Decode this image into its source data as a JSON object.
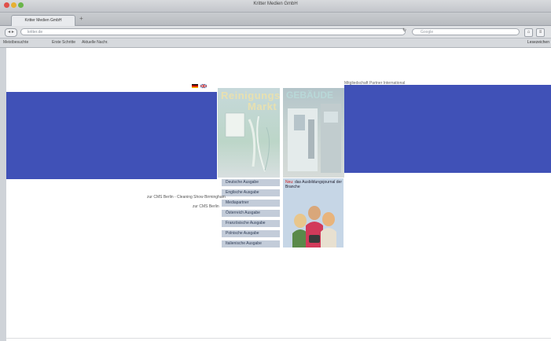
{
  "window": {
    "title": "Kritter Medien GmbH"
  },
  "tab": {
    "label": "Kritter Medien GmbH",
    "newtab": "+"
  },
  "toolbar": {
    "back": "◂ ▸",
    "url": "kritter.de",
    "reload": "↻",
    "search_placeholder": "Google",
    "home": "⌂",
    "menu": "≡"
  },
  "bookmarks": {
    "items": [
      "Meistbesuchte",
      "Erste Schritte",
      "Aktuelle Nachr."
    ],
    "right": "Lesezeichen"
  },
  "page": {
    "partner_link": "Mitgliedschaft Partner International",
    "mag1": {
      "line1": "Reinigungs",
      "line2": "Markt"
    },
    "mag2": {
      "title": "GEBÄUDE"
    },
    "editions": [
      "Deutsche Ausgabe",
      "Englische Ausgabe",
      "Mediapartner",
      "Österreich Ausgabe",
      "Französische Ausgabe",
      "Polnische Ausgabe",
      "Italienische Ausgabe"
    ],
    "promo": {
      "new": "Neu:",
      "text": "das Ausbildungsjournal der Branche"
    },
    "links": {
      "cms_line1": "zur CMS Berlin - Cleaning Show Birmingham",
      "cms_line2": "zur CMS Berlin"
    }
  },
  "colors": {
    "band": "#4051b7",
    "edition_bg": "#c3ccd9",
    "promo_bg": "#c6d6e6"
  }
}
